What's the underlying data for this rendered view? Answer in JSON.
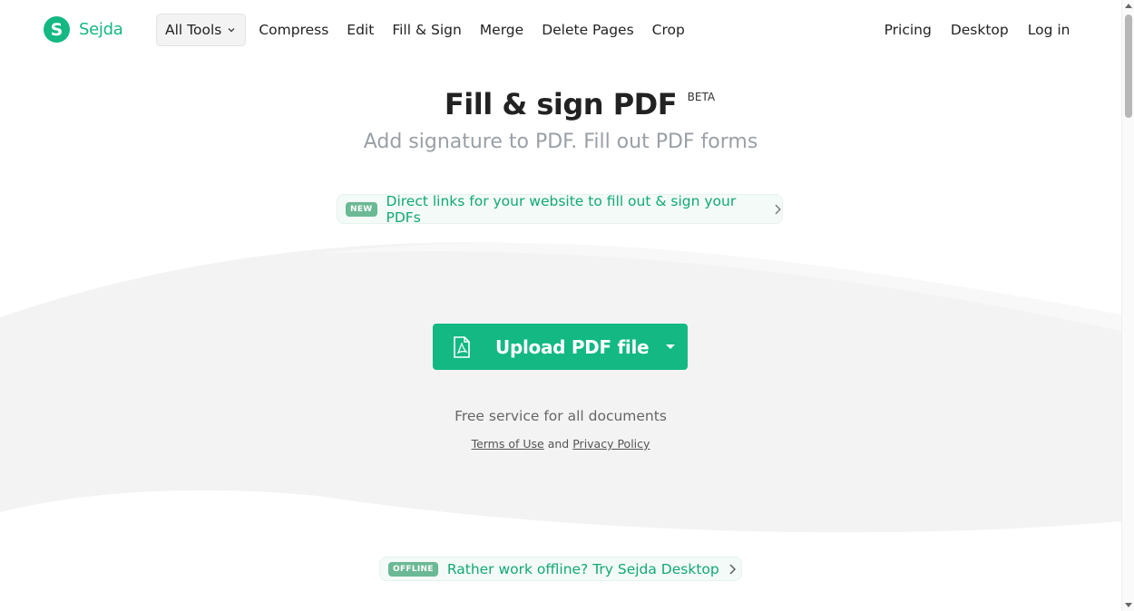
{
  "brand": {
    "name": "Sejda",
    "mark": "S",
    "color": "#13b883"
  },
  "nav": {
    "all_tools": "All Tools",
    "items": [
      "Compress",
      "Edit",
      "Fill & Sign",
      "Merge",
      "Delete Pages",
      "Crop"
    ],
    "right": [
      "Pricing",
      "Desktop",
      "Log in"
    ]
  },
  "hero": {
    "title": "Fill & sign PDF",
    "beta": "BETA",
    "subtitle": "Add signature to PDF. Fill out PDF forms"
  },
  "promo": {
    "badge": "NEW",
    "text": "Direct links for your website to fill out & sign your PDFs"
  },
  "upload": {
    "label": "Upload PDF file",
    "icon": "pdf-file-icon"
  },
  "info": {
    "free": "Free service for all documents",
    "terms": "Terms of Use",
    "and": "and",
    "privacy": "Privacy Policy"
  },
  "offline": {
    "badge": "OFFLINE",
    "text": "Rather work offline? Try Sejda Desktop"
  }
}
